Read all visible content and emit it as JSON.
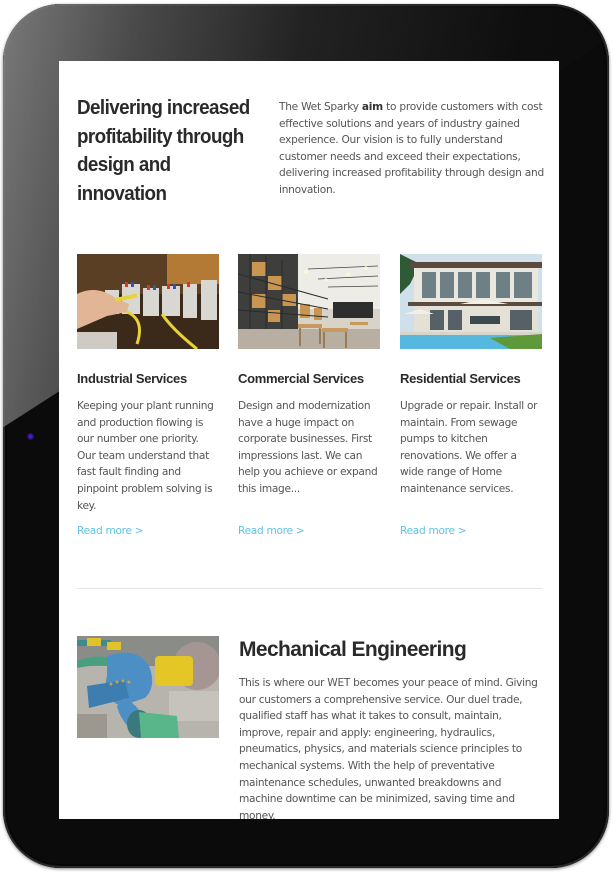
{
  "intro": {
    "heading": "Delivering increased profitability through design and innovation",
    "text_before_bold": "The Wet Sparky ",
    "bold_word": "aim",
    "text_after_bold": " to provide customers with cost effective solutions and years of industry gained experience. Our vision is to fully understand customer needs and exceed their expectations, delivering increased profitability through design and innovation."
  },
  "services": [
    {
      "title": "Industrial Services",
      "description": "Keeping your plant running and production flowing is our number one priority. Our team understand that fast fault finding and pinpoint problem solving is key.",
      "link": "Read more >",
      "image_alt": "Electrician working on an industrial control panel with wiring"
    },
    {
      "title": "Commercial Services",
      "description": "Design and modernization have a huge impact on corporate businesses. First impressions last. We can help you achieve or expand this image...",
      "link": "Read more >",
      "image_alt": "Modern commercial interior with shelving and pendant lights"
    },
    {
      "title": "Residential Services",
      "description": "Upgrade or repair. Install or maintain. From sewage pumps to kitchen renovations. We offer a wide range of Home maintenance services.",
      "link": "Read more >",
      "image_alt": "Modern house with swimming pool and patio umbrellas"
    }
  ],
  "mechanical": {
    "title": "Mechanical Engineering",
    "description": "This is where our WET becomes your peace of mind. Giving our customers a comprehensive service. Our duel trade, qualified staff has what it takes to consult, maintain, improve, repair and apply: engineering, hydraulics, pneumatics, physics, and materials science principles to mechanical systems. With the help of preventative maintenance schedules, unwanted breakdowns and machine downtime can be minimized, saving time and money.",
    "image_alt": "Blue industrial water pump with yellow coupling guard"
  },
  "colors": {
    "link": "#5fc2e3",
    "heading": "#2a2a2a",
    "body_text": "#555555",
    "bezel": "#0b0b0b"
  }
}
